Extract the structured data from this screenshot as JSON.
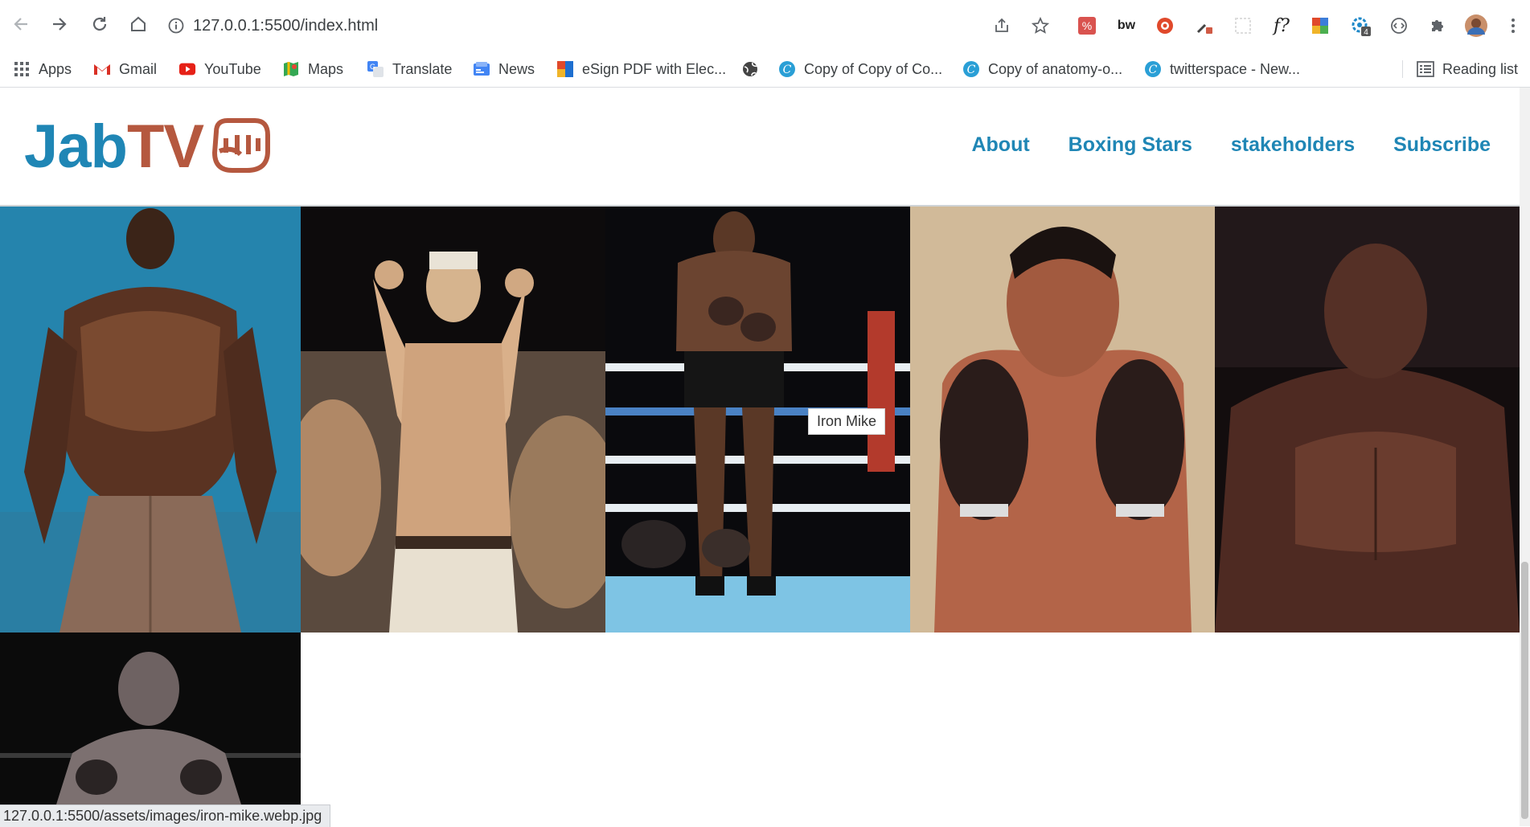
{
  "browser": {
    "url": "127.0.0.1:5500/index.html",
    "bookmarks": [
      {
        "label": "Apps",
        "icon": "apps-grid-icon"
      },
      {
        "label": "Gmail",
        "icon": "gmail-icon"
      },
      {
        "label": "YouTube",
        "icon": "youtube-icon"
      },
      {
        "label": "Maps",
        "icon": "maps-icon"
      },
      {
        "label": "Translate",
        "icon": "translate-icon"
      },
      {
        "label": "News",
        "icon": "news-icon"
      },
      {
        "label": "eSign PDF with Elec...",
        "icon": "esign-icon"
      },
      {
        "label": "",
        "icon": "globe-icon"
      },
      {
        "label": "Copy of Copy of Co...",
        "icon": "canva-icon"
      },
      {
        "label": "Copy of anatomy-o...",
        "icon": "canva-icon"
      },
      {
        "label": "twitterspace - New...",
        "icon": "canva-icon"
      }
    ],
    "reading_list": "Reading list",
    "extension_badge": "4",
    "status_url": "127.0.0.1:5500/assets/images/iron-mike.webp.jpg"
  },
  "site": {
    "logo_jab": "Jab",
    "logo_tv": "TV",
    "nav": [
      "About",
      "Boxing Stars",
      "stakeholders",
      "Subscribe"
    ],
    "tooltip": "Iron Mike"
  },
  "colors": {
    "brand_blue": "#1f86b5",
    "brand_rust": "#b5583f"
  }
}
